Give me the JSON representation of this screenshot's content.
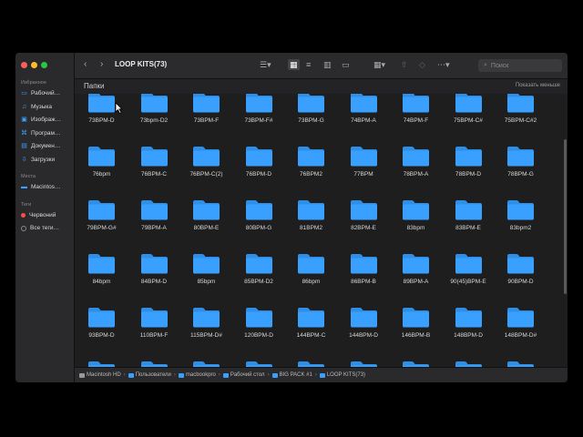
{
  "window": {
    "title": "LOOP KITS(73)"
  },
  "sidebar": {
    "sections": [
      {
        "label": "Избранное",
        "items": [
          {
            "label": "Рабочий…",
            "icon": "desktop-icon"
          },
          {
            "label": "Музыка",
            "icon": "music-icon"
          },
          {
            "label": "Изображ…",
            "icon": "pictures-icon"
          },
          {
            "label": "Програм…",
            "icon": "applications-icon"
          },
          {
            "label": "Докумен…",
            "icon": "document-icon"
          },
          {
            "label": "Загрузки",
            "icon": "downloads-icon"
          }
        ]
      },
      {
        "label": "Места",
        "items": [
          {
            "label": "Macintos…",
            "icon": "disk-icon"
          }
        ]
      },
      {
        "label": "Теги",
        "items": [
          {
            "label": "Червоний",
            "icon": "tag-red-icon",
            "color": "#ff4b4b"
          },
          {
            "label": "Все теги…",
            "icon": "tag-all-icon",
            "color": "#888888"
          }
        ]
      }
    ]
  },
  "search": {
    "placeholder": "Поиск"
  },
  "header": {
    "section_label": "Папки",
    "toggle_label": "Показать меньше"
  },
  "folders": [
    "73BPM-D",
    "73bpm-D2",
    "73BPM-F",
    "73BPM-F#",
    "73BPM-G",
    "74BPM-A",
    "74BPM-F",
    "75BPM-C#",
    "75BPM-C#2",
    "76bpm",
    "76BPM-C",
    "76BPM-C(2)",
    "76BPM-D",
    "76BPM2",
    "77BPM",
    "78BPM-A",
    "78BPM-D",
    "78BPM-G",
    "79BPM-G#",
    "79BPM-A",
    "80BPM-E",
    "80BPM-G",
    "81BPM2",
    "82BPM-E",
    "83bpm",
    "83BPM-E",
    "83bpm2",
    "84bpm",
    "84BPM-D",
    "85bpm",
    "85BPM-D2",
    "86bpm",
    "86BPM-B",
    "89BPM-A",
    "90(45)BPM-E",
    "90BPM-D",
    "93BPM-D",
    "110BPM-F",
    "115BPM-D#",
    "120BPM-D",
    "144BPM-C",
    "144BPM-D",
    "146BPM-B",
    "148BPM-D",
    "148BPM-D#"
  ],
  "path": [
    "Macintosh HD",
    "Пользователи",
    "macbookpro",
    "Рабочий стол",
    "BIG PACK #1",
    "LOOP KITS(73)"
  ],
  "colors": {
    "folder": "#3aa0ff",
    "folder_tab": "#2f8fe6",
    "accent": "#3aa0ff"
  }
}
